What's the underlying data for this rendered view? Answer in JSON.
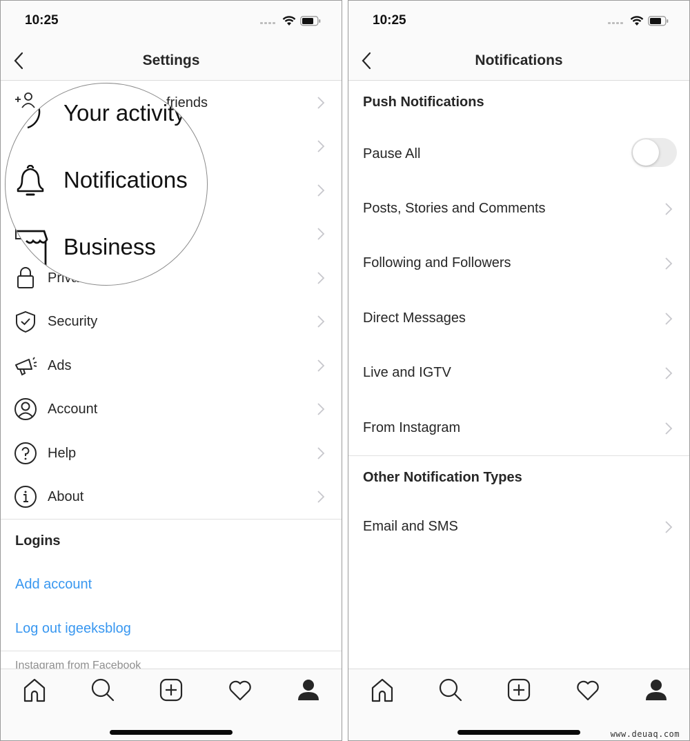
{
  "left_screen": {
    "status_bar": {
      "time": "10:25"
    },
    "nav": {
      "title": "Settings",
      "back_icon": "chevron-left-icon"
    },
    "settings_items": [
      {
        "label": "Follow and invite friends",
        "visible_label": "friends",
        "icon": "add-person-icon"
      },
      {
        "label": "Your activity",
        "icon": "activity-icon"
      },
      {
        "label": "Notifications",
        "icon": "bell-icon"
      },
      {
        "label": "Business",
        "icon": "shop-icon"
      },
      {
        "label": "Privacy",
        "visible_label": "Priva",
        "icon": "lock-icon"
      },
      {
        "label": "Security",
        "icon": "shield-check-icon"
      },
      {
        "label": "Ads",
        "icon": "megaphone-icon"
      },
      {
        "label": "Account",
        "icon": "person-circle-icon"
      },
      {
        "label": "Help",
        "icon": "help-circle-icon"
      },
      {
        "label": "About",
        "icon": "info-circle-icon"
      }
    ],
    "magnifier": {
      "items": [
        "Your activity",
        "Notifications",
        "Business"
      ]
    },
    "logins": {
      "heading": "Logins",
      "add_account": "Add account",
      "log_out": "Log out igeeksblog"
    },
    "footer": "Instagram from Facebook"
  },
  "right_screen": {
    "status_bar": {
      "time": "10:25"
    },
    "nav": {
      "title": "Notifications",
      "back_icon": "chevron-left-icon"
    },
    "push_section": {
      "heading": "Push Notifications",
      "pause_all": {
        "label": "Pause All",
        "enabled": false
      },
      "items": [
        "Posts, Stories and Comments",
        "Following and Followers",
        "Direct Messages",
        "Live and IGTV",
        "From Instagram"
      ]
    },
    "other_section": {
      "heading": "Other Notification Types",
      "items": [
        "Email and SMS"
      ]
    }
  },
  "tab_bar": {
    "tabs": [
      {
        "name": "home",
        "icon": "home-icon"
      },
      {
        "name": "search",
        "icon": "search-icon"
      },
      {
        "name": "new-post",
        "icon": "plus-square-icon"
      },
      {
        "name": "activity",
        "icon": "heart-icon"
      },
      {
        "name": "profile",
        "icon": "profile-icon"
      }
    ]
  },
  "colors": {
    "link_blue": "#3897f0",
    "text": "#262626",
    "muted": "#8e8e8e",
    "divider": "#dbdbdb",
    "chevron": "#c7c7cc"
  },
  "watermark": "www.deuaq.com"
}
